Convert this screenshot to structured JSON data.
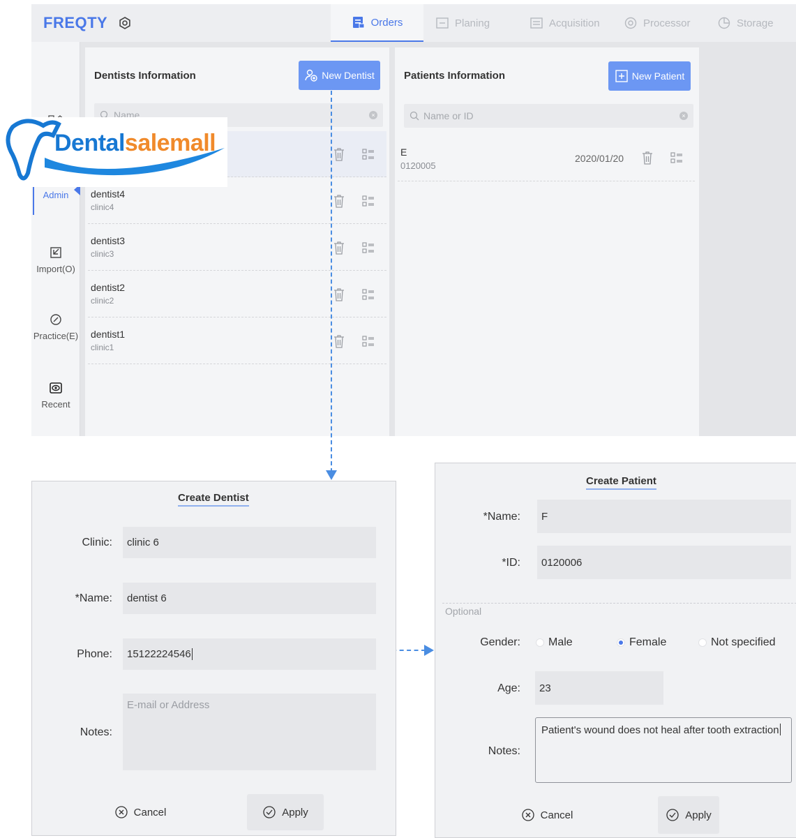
{
  "app": {
    "brand": "FREQTY",
    "tabs": [
      {
        "label": "Orders",
        "icon": "orders-icon"
      },
      {
        "label": "Planing",
        "icon": "planning-icon"
      },
      {
        "label": "Acquisition",
        "icon": "acquisition-icon"
      },
      {
        "label": "Processor",
        "icon": "processor-icon"
      },
      {
        "label": "Storage",
        "icon": "storage-icon"
      }
    ],
    "active_tab": "Orders",
    "sidebar": [
      {
        "label": "Admin",
        "icon": "admin-icon",
        "active": true
      },
      {
        "label": "Import(O)",
        "icon": "import-icon"
      },
      {
        "label": "Practice(E)",
        "icon": "practice-icon"
      },
      {
        "label": "Recent",
        "icon": "recent-icon"
      }
    ],
    "accent_color": "#4a78e8"
  },
  "dentists": {
    "title": "Dentists Information",
    "new_button": "New Dentist",
    "search_placeholder": "Name",
    "rows": [
      {
        "name": "dentist4",
        "clinic": "clinic4"
      },
      {
        "name": "dentist3",
        "clinic": "clinic3"
      },
      {
        "name": "dentist2",
        "clinic": "clinic2"
      },
      {
        "name": "dentist1",
        "clinic": "clinic1"
      }
    ]
  },
  "patients": {
    "title": "Patients Information",
    "new_button": "New Patient",
    "search_placeholder": "Name or ID",
    "rows": [
      {
        "name": "E",
        "id": "0120005",
        "date": "2020/01/20"
      }
    ]
  },
  "watermark": {
    "part1": "Dental",
    "part2": "salemall"
  },
  "create_dentist": {
    "title": "Create Dentist",
    "clinic_label": "Clinic:",
    "clinic_value": "clinic 6",
    "name_label": "*Name:",
    "name_value": "dentist 6",
    "phone_label": "Phone:",
    "phone_value": "15122224546",
    "notes_label": "Notes:",
    "notes_placeholder": "E-mail or Address",
    "cancel": "Cancel",
    "apply": "Apply"
  },
  "create_patient": {
    "title": "Create Patient",
    "name_label": "*Name:",
    "name_value": "F",
    "id_label": "*ID:",
    "id_value": "0120006",
    "optional": "Optional",
    "gender_label": "Gender:",
    "genders": [
      "Male",
      "Female",
      "Not specified"
    ],
    "gender_selected": "Female",
    "age_label": "Age:",
    "age_value": "23",
    "notes_label": "Notes:",
    "notes_value": "Patient's wound does not heal after tooth extraction",
    "cancel": "Cancel",
    "apply": "Apply"
  }
}
